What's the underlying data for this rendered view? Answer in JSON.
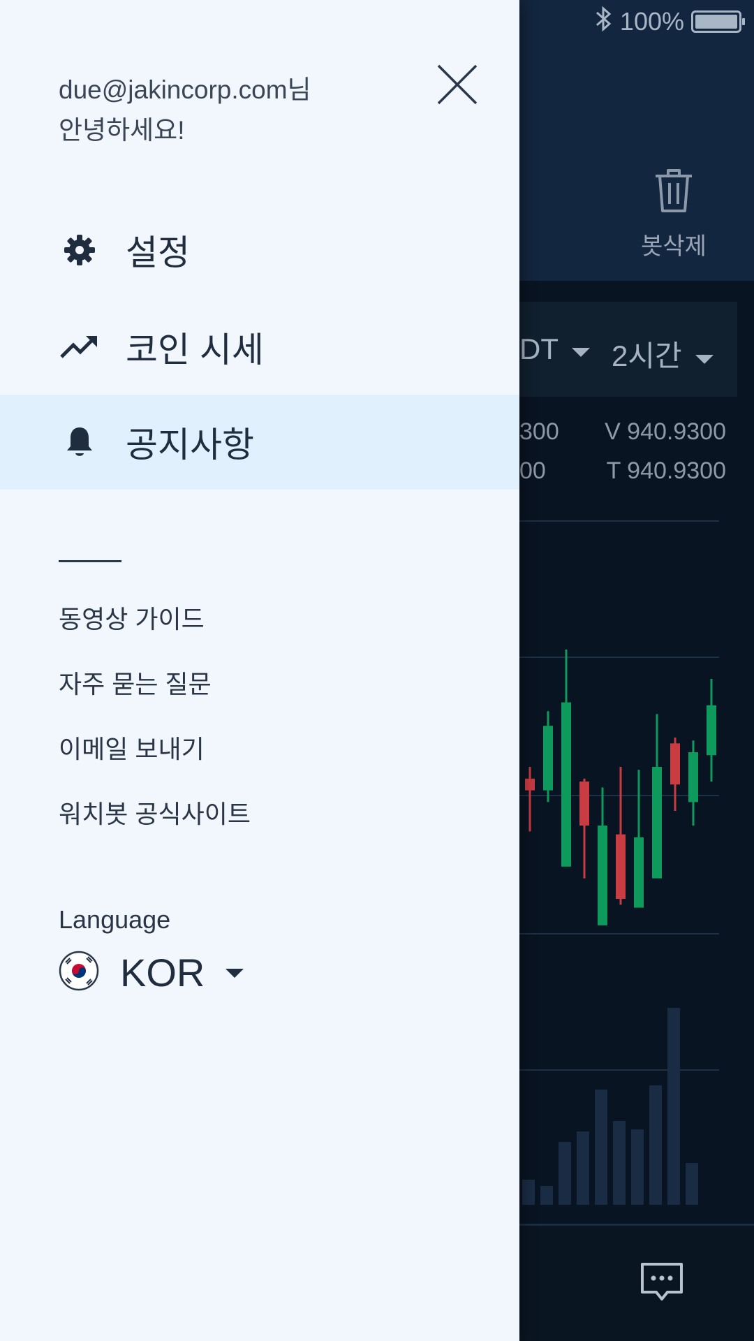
{
  "status_bar": {
    "battery": "100%"
  },
  "background": {
    "delete_label": "봇삭제",
    "market_partial": "DT",
    "timeframe": "2시간",
    "values_left": [
      "300",
      "00"
    ],
    "values_right": [
      "V 940.9300",
      "T 940.9300"
    ],
    "candles": [
      {
        "o": 48,
        "c": 44,
        "h": 40,
        "l": 62,
        "dir": "down"
      },
      {
        "o": 48,
        "c": 26,
        "h": 21,
        "l": 52,
        "dir": "up"
      },
      {
        "o": 74,
        "c": 18,
        "h": 0,
        "l": 66,
        "dir": "up"
      },
      {
        "o": 45,
        "c": 60,
        "h": 44,
        "l": 78,
        "dir": "down"
      },
      {
        "o": 94,
        "c": 60,
        "h": 47,
        "l": 93,
        "dir": "up"
      },
      {
        "o": 63,
        "c": 85,
        "h": 40,
        "l": 87,
        "dir": "down"
      },
      {
        "o": 88,
        "c": 64,
        "h": 41,
        "l": 80,
        "dir": "up"
      },
      {
        "o": 78,
        "c": 40,
        "h": 22,
        "l": 75,
        "dir": "up"
      },
      {
        "o": 32,
        "c": 46,
        "h": 30,
        "l": 55,
        "dir": "down"
      },
      {
        "o": 52,
        "c": 35,
        "h": 31,
        "l": 60,
        "dir": "up"
      },
      {
        "o": 36,
        "c": 19,
        "h": 10,
        "l": 45,
        "dir": "up"
      }
    ],
    "volumes": [
      12,
      9,
      30,
      35,
      55,
      40,
      36,
      57,
      94,
      20
    ]
  },
  "drawer": {
    "greeting_line1": "due@jakincorp.com님",
    "greeting_line2": "안녕하세요!",
    "menu": [
      {
        "label": "설정",
        "icon": "gear-icon"
      },
      {
        "label": "코인 시세",
        "icon": "trending-up-icon"
      },
      {
        "label": "공지사항",
        "icon": "bell-icon",
        "active": true
      }
    ],
    "links": [
      "동영상 가이드",
      "자주 묻는 질문",
      "이메일 보내기",
      "워치봇 공식사이트"
    ],
    "language_label": "Language",
    "language_code": "KOR"
  }
}
